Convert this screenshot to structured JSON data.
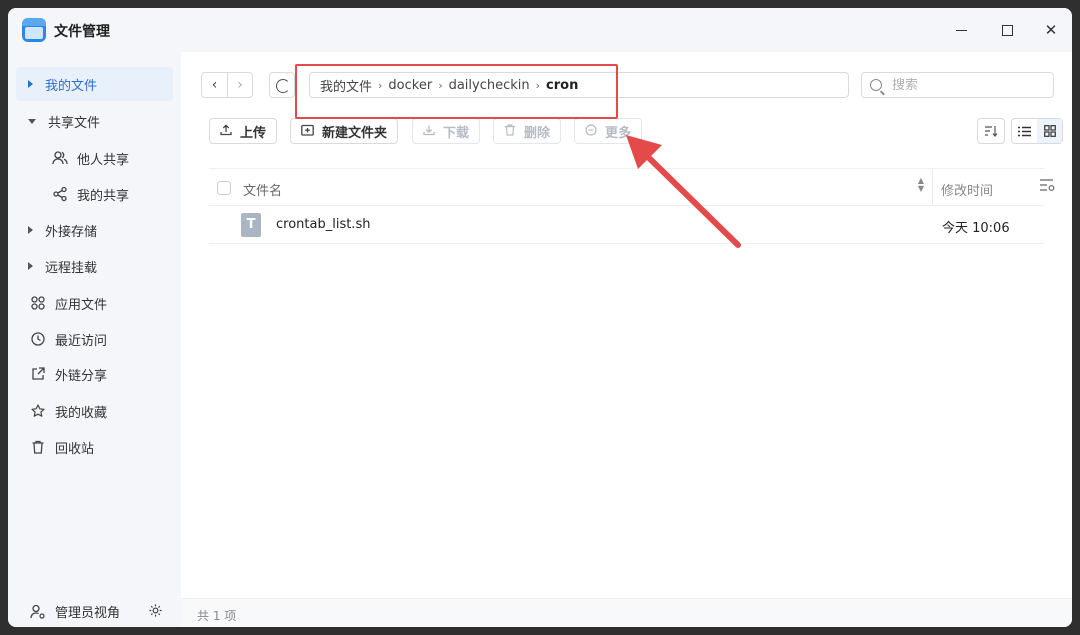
{
  "app": {
    "title": "文件管理"
  },
  "sidebar": {
    "items": [
      {
        "label": "我的文件"
      },
      {
        "label": "共享文件"
      },
      {
        "label": "他人共享"
      },
      {
        "label": "我的共享"
      },
      {
        "label": "外接存储"
      },
      {
        "label": "远程挂载"
      },
      {
        "label": "应用文件"
      },
      {
        "label": "最近访问"
      },
      {
        "label": "外链分享"
      },
      {
        "label": "我的收藏"
      },
      {
        "label": "回收站"
      }
    ],
    "footer": {
      "label": "管理员视角"
    }
  },
  "breadcrumb": [
    "我的文件",
    "docker",
    "dailycheckin",
    "cron"
  ],
  "search": {
    "placeholder": "搜索"
  },
  "toolbar": {
    "upload": "上传",
    "new_folder": "新建文件夹",
    "download": "下载",
    "delete": "删除",
    "more": "更多"
  },
  "table": {
    "columns": {
      "name": "文件名",
      "mtime": "修改时间"
    },
    "rows": [
      {
        "icon": "T",
        "name": "crontab_list.sh",
        "mtime": "今天 10:06"
      }
    ]
  },
  "status": {
    "count": "共 1 项"
  },
  "colors": {
    "accent": "#2b6fce",
    "annotation": "#e44a4a"
  }
}
